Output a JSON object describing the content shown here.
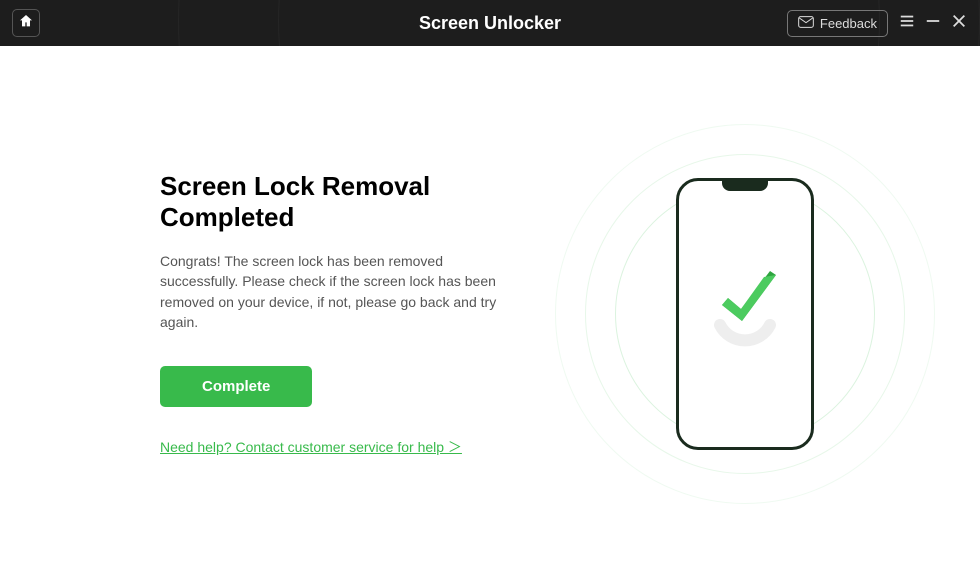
{
  "header": {
    "title": "Screen Unlocker",
    "feedback_label": "Feedback"
  },
  "main": {
    "heading": "Screen Lock Removal Completed",
    "description": "Congrats! The screen lock has been removed successfully. Please check if the screen lock has been removed on your device, if not, please go back and try again.",
    "complete_button": "Complete",
    "help_link": "Need help? Contact customer service for help ＞"
  },
  "colors": {
    "accent": "#38ba4b"
  }
}
